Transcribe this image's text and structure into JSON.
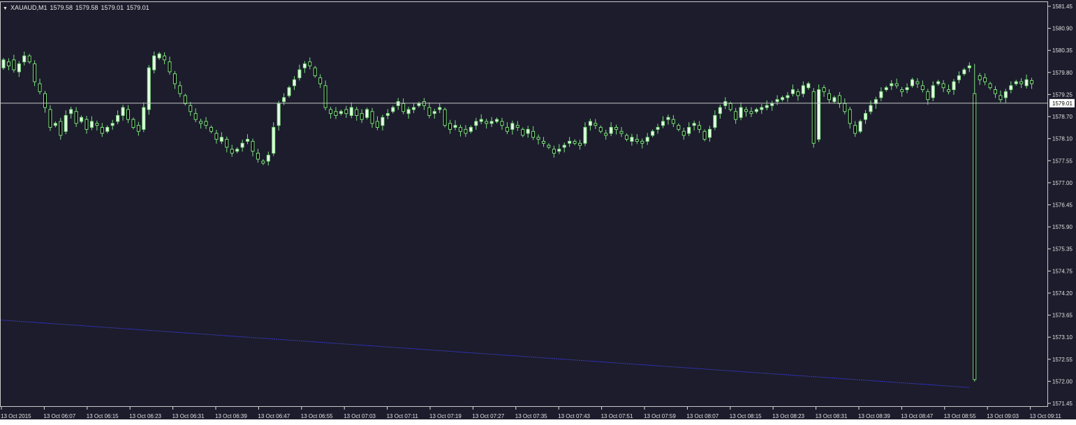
{
  "header": {
    "symbol": "XAUAUD,M1",
    "open": "1579.58",
    "high": "1579.58",
    "low": "1579.01",
    "close": "1579.01"
  },
  "colors": {
    "background": "#1c1c2c",
    "candle": "#7ee07e",
    "candle_body_bull": "#eaffea",
    "axis_text": "#e0e0e0",
    "price_line": "#c8c8c8",
    "trendline": "#3a3ad0"
  },
  "chart_data": {
    "type": "candlestick",
    "title": "XAUAUD,M1",
    "xlabel": "",
    "ylabel": "",
    "ylim": [
      1571.45,
      1581.45
    ],
    "grid": false,
    "y_ticks": [
      "1581.45",
      "1580.90",
      "1580.35",
      "1579.80",
      "1579.25",
      "1578.70",
      "1578.10",
      "1577.55",
      "1577.00",
      "1576.45",
      "1575.90",
      "1575.35",
      "1574.75",
      "1574.20",
      "1573.65",
      "1573.10",
      "1572.55",
      "1572.00",
      "1571.45"
    ],
    "x_ticks": [
      "13 Oct 2015",
      "13 Oct 06:07",
      "13 Oct 06:15",
      "13 Oct 06:23",
      "13 Oct 06:31",
      "13 Oct 06:39",
      "13 Oct 06:47",
      "13 Oct 06:55",
      "13 Oct 07:03",
      "13 Oct 07:11",
      "13 Oct 07:19",
      "13 Oct 07:27",
      "13 Oct 07:35",
      "13 Oct 07:43",
      "13 Oct 07:51",
      "13 Oct 07:59",
      "13 Oct 08:07",
      "13 Oct 08:15",
      "13 Oct 08:23",
      "13 Oct 08:31",
      "13 Oct 08:39",
      "13 Oct 08:47",
      "13 Oct 08:55",
      "13 Oct 09:03",
      "13 Oct 09:11"
    ],
    "current_price": "1579.01",
    "current_value": 1579.01,
    "trendline": {
      "from": [
        0,
        1573.55
      ],
      "to": [
        187,
        1571.85
      ]
    },
    "spike_index": 187,
    "closes": [
      1580.1,
      1579.95,
      1579.85,
      1580.0,
      1580.2,
      1580.05,
      1579.55,
      1579.3,
      1578.9,
      1578.4,
      1578.5,
      1578.2,
      1578.7,
      1578.85,
      1578.5,
      1578.65,
      1578.35,
      1578.55,
      1578.45,
      1578.25,
      1578.4,
      1578.5,
      1578.7,
      1578.9,
      1578.6,
      1578.4,
      1578.3,
      1578.9,
      1579.9,
      1580.2,
      1580.25,
      1580.1,
      1579.8,
      1579.5,
      1579.25,
      1579.0,
      1578.8,
      1578.6,
      1578.5,
      1578.45,
      1578.3,
      1578.1,
      1578.15,
      1577.9,
      1577.75,
      1577.85,
      1578.0,
      1578.1,
      1577.8,
      1577.6,
      1577.5,
      1577.7,
      1578.4,
      1579.0,
      1579.15,
      1579.4,
      1579.6,
      1579.85,
      1580.0,
      1579.95,
      1579.7,
      1579.5,
      1578.9,
      1578.75,
      1578.7,
      1578.8,
      1578.75,
      1578.9,
      1578.7,
      1578.6,
      1578.85,
      1578.5,
      1578.4,
      1578.65,
      1578.75,
      1578.9,
      1579.05,
      1578.8,
      1578.85,
      1578.9,
      1579.0,
      1578.95,
      1578.7,
      1578.8,
      1578.9,
      1578.45,
      1578.35,
      1578.45,
      1578.3,
      1578.25,
      1578.4,
      1578.55,
      1578.6,
      1578.5,
      1578.55,
      1578.6,
      1578.45,
      1578.3,
      1578.5,
      1578.4,
      1578.2,
      1578.35,
      1578.15,
      1578.1,
      1578.0,
      1577.9,
      1577.75,
      1577.85,
      1577.95,
      1578.05,
      1578.0,
      1577.95,
      1578.4,
      1578.55,
      1578.45,
      1578.3,
      1578.2,
      1578.4,
      1578.35,
      1578.25,
      1578.1,
      1578.15,
      1578.05,
      1578.0,
      1578.15,
      1578.3,
      1578.4,
      1578.55,
      1578.65,
      1578.5,
      1578.35,
      1578.2,
      1578.4,
      1578.5,
      1578.35,
      1578.1,
      1578.35,
      1578.7,
      1578.9,
      1579.05,
      1578.85,
      1578.6,
      1578.9,
      1578.8,
      1578.75,
      1578.85,
      1578.9,
      1578.95,
      1579.0,
      1579.1,
      1579.15,
      1579.2,
      1579.35,
      1579.2,
      1579.45,
      1579.5,
      1578.0,
      1579.35,
      1579.3,
      1579.1,
      1579.15,
      1579.0,
      1578.8,
      1578.5,
      1578.25,
      1578.55,
      1578.75,
      1578.95,
      1579.1,
      1579.3,
      1579.4,
      1579.5,
      1579.45,
      1579.3,
      1579.4,
      1579.6,
      1579.5,
      1579.35,
      1579.1,
      1579.45,
      1579.55,
      1579.4,
      1579.3,
      1579.55,
      1579.7,
      1579.85,
      1579.95,
      1579.75,
      1579.6,
      1579.55,
      1579.4,
      1579.25,
      1579.1,
      1579.3,
      1579.45,
      1579.55,
      1579.5,
      1579.6,
      1579.5,
      1579.01
    ],
    "opens": [
      1579.9,
      1580.05,
      1580.1,
      1579.8,
      1580.05,
      1580.2,
      1580.0,
      1579.5,
      1579.25,
      1578.85,
      1578.45,
      1578.55,
      1578.3,
      1578.75,
      1578.8,
      1578.55,
      1578.6,
      1578.4,
      1578.5,
      1578.4,
      1578.3,
      1578.45,
      1578.55,
      1578.7,
      1578.85,
      1578.6,
      1578.45,
      1578.35,
      1578.85,
      1579.85,
      1580.15,
      1580.2,
      1580.05,
      1579.75,
      1579.45,
      1579.2,
      1578.95,
      1578.75,
      1578.55,
      1578.55,
      1578.4,
      1578.25,
      1578.05,
      1578.1,
      1577.85,
      1577.8,
      1577.9,
      1578.05,
      1578.05,
      1577.75,
      1577.55,
      1577.55,
      1577.75,
      1578.45,
      1579.05,
      1579.2,
      1579.45,
      1579.65,
      1579.9,
      1580.05,
      1579.9,
      1579.65,
      1579.45,
      1578.85,
      1578.8,
      1578.75,
      1578.85,
      1578.7,
      1578.85,
      1578.75,
      1578.65,
      1578.8,
      1578.55,
      1578.45,
      1578.7,
      1578.8,
      1578.95,
      1579.0,
      1578.75,
      1578.85,
      1578.95,
      1579.05,
      1578.9,
      1578.75,
      1578.85,
      1578.85,
      1578.5,
      1578.4,
      1578.4,
      1578.35,
      1578.3,
      1578.45,
      1578.55,
      1578.55,
      1578.5,
      1578.55,
      1578.55,
      1578.4,
      1578.35,
      1578.45,
      1578.35,
      1578.25,
      1578.3,
      1578.15,
      1578.05,
      1577.95,
      1577.85,
      1577.8,
      1577.9,
      1578.0,
      1578.05,
      1578.0,
      1578.0,
      1578.45,
      1578.5,
      1578.4,
      1578.25,
      1578.25,
      1578.4,
      1578.3,
      1578.2,
      1578.05,
      1578.1,
      1578.05,
      1578.05,
      1578.2,
      1578.35,
      1578.45,
      1578.6,
      1578.6,
      1578.45,
      1578.3,
      1578.25,
      1578.45,
      1578.45,
      1578.3,
      1578.15,
      1578.4,
      1578.75,
      1578.95,
      1579.0,
      1578.8,
      1578.65,
      1578.85,
      1578.8,
      1578.8,
      1578.85,
      1578.9,
      1578.95,
      1579.05,
      1579.1,
      1579.15,
      1579.25,
      1579.3,
      1579.25,
      1579.4,
      1579.3,
      1578.1,
      1579.4,
      1579.25,
      1579.05,
      1579.2,
      1579.0,
      1578.85,
      1578.45,
      1578.3,
      1578.6,
      1578.8,
      1579.0,
      1579.15,
      1579.35,
      1579.45,
      1579.5,
      1579.35,
      1579.35,
      1579.45,
      1579.55,
      1579.45,
      1579.3,
      1579.15,
      1579.5,
      1579.5,
      1579.35,
      1579.35,
      1579.6,
      1579.75,
      1579.9,
      1579.9,
      1579.7,
      1579.65,
      1579.5,
      1579.35,
      1579.2,
      1579.15,
      1579.35,
      1579.5,
      1579.55,
      1579.45,
      1579.58
    ]
  }
}
